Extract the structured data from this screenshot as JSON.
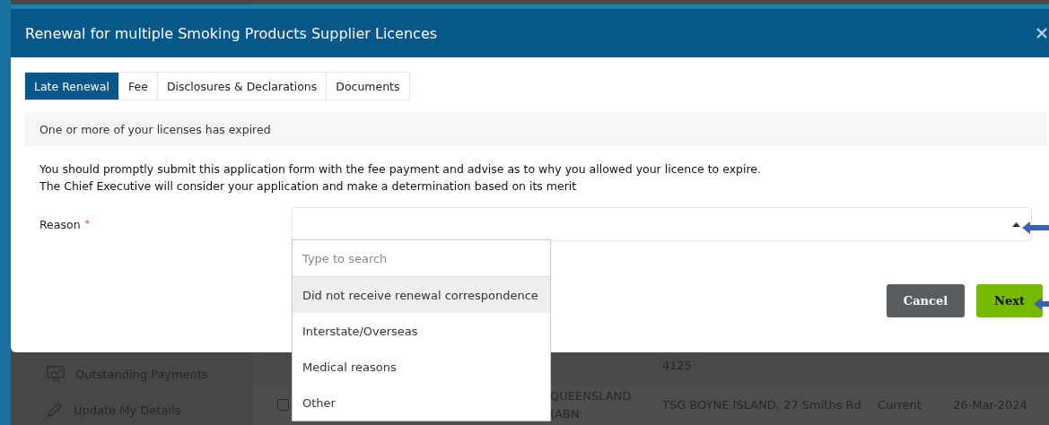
{
  "background_page": {
    "sidebar_items": [
      "Outstanding Payments",
      "Update My Details"
    ],
    "table_rows": [
      {
        "address": "4125"
      },
      {
        "name_lines": [
          "QUEENSLAND",
          "(ABN:"
        ],
        "checked": false,
        "address": "TSG BOYNE ISLAND, 27 Smiths Rd",
        "status": "Current",
        "date": "26-Mar-2024"
      }
    ]
  },
  "dialog": {
    "title": "Renewal for multiple Smoking Products Supplier Licences",
    "tabs": [
      {
        "label": "Late Renewal",
        "selected": true
      },
      {
        "label": "Fee",
        "selected": false
      },
      {
        "label": "Disclosures & Declarations",
        "selected": false
      },
      {
        "label": "Documents",
        "selected": false
      }
    ],
    "notice": "One or more of your licenses has expired",
    "instructions": [
      "You should promptly submit this application form with the fee payment and advise as to why you allowed your licence to expire.",
      "The Chief Executive will consider your application and make a determination based on its merit"
    ],
    "reason_field": {
      "label": "Reason",
      "required_mark": "*",
      "expanded": true,
      "dropdown": {
        "placeholder": "Type to search",
        "options": [
          {
            "label": "Did not receive renewal correspondence",
            "highlighted": true
          },
          {
            "label": "Interstate/Overseas",
            "highlighted": false
          },
          {
            "label": "Medical reasons",
            "highlighted": false
          },
          {
            "label": "Other",
            "highlighted": false
          }
        ]
      }
    },
    "buttons": [
      {
        "label": "Cancel",
        "kind": "secondary"
      },
      {
        "label": "Next",
        "kind": "primary"
      }
    ]
  }
}
